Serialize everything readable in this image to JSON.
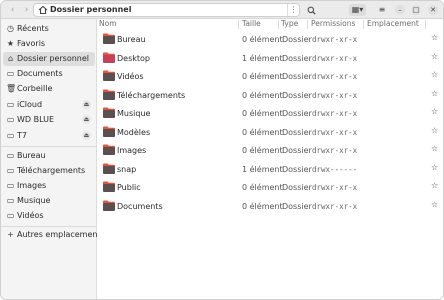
{
  "header": {
    "path_label": "Dossier personnel"
  },
  "sidebar": {
    "top": [
      {
        "label": "Récents",
        "icon": "clock-icon"
      },
      {
        "label": "Favoris",
        "icon": "star-icon"
      },
      {
        "label": "Dossier personnel",
        "icon": "home-icon",
        "active": true
      },
      {
        "label": "Documents",
        "icon": "document-icon"
      },
      {
        "label": "Corbeille",
        "icon": "trash-icon"
      },
      {
        "label": "iCloud",
        "icon": "drive-icon"
      },
      {
        "label": "WD BLUE",
        "icon": "drive-icon"
      },
      {
        "label": "T7",
        "icon": "drive-icon"
      }
    ],
    "bookmarks": [
      {
        "label": "Bureau",
        "icon": "folder-icon"
      },
      {
        "label": "Téléchargements",
        "icon": "folder-icon"
      },
      {
        "label": "Images",
        "icon": "folder-icon"
      },
      {
        "label": "Musique",
        "icon": "folder-icon"
      },
      {
        "label": "Vidéos",
        "icon": "folder-icon"
      }
    ],
    "other_locations": "Autres emplacements"
  },
  "columns": {
    "name": "Nom",
    "size": "Taille",
    "type": "Type",
    "permissions": "Permissions",
    "location": "Emplacement"
  },
  "rows": [
    {
      "name": "Bureau",
      "size": "0 élément",
      "type": "Dossier",
      "perm": "drwxr-xr-x",
      "icon": "folder-icon"
    },
    {
      "name": "Desktop",
      "size": "1 élément",
      "type": "Dossier",
      "perm": "drwxr-xr-x",
      "icon": "folder-icon"
    },
    {
      "name": "Vidéos",
      "size": "0 élément",
      "type": "Dossier",
      "perm": "drwxr-xr-x",
      "icon": "video-folder-icon"
    },
    {
      "name": "Téléchargements",
      "size": "0 élément",
      "type": "Dossier",
      "perm": "drwxr-xr-x",
      "icon": "download-folder-icon"
    },
    {
      "name": "Musique",
      "size": "0 élément",
      "type": "Dossier",
      "perm": "drwxr-xr-x",
      "icon": "music-folder-icon"
    },
    {
      "name": "Modèles",
      "size": "0 élément",
      "type": "Dossier",
      "perm": "drwxr-xr-x",
      "icon": "template-folder-icon"
    },
    {
      "name": "Images",
      "size": "0 élément",
      "type": "Dossier",
      "perm": "drwxr-xr-x",
      "icon": "image-folder-icon"
    },
    {
      "name": "snap",
      "size": "1 élément",
      "type": "Dossier",
      "perm": "drwx------",
      "icon": "folder-icon"
    },
    {
      "name": "Public",
      "size": "0 élément",
      "type": "Dossier",
      "perm": "drwxr-xr-x",
      "icon": "share-folder-icon"
    },
    {
      "name": "Documents",
      "size": "0 élément",
      "type": "Dossier",
      "perm": "drwxr-xr-x",
      "icon": "document-folder-icon"
    }
  ],
  "colors": {
    "folder": "#5b4f52",
    "folder_tab": "#e8533a",
    "selection": "#dedede"
  }
}
